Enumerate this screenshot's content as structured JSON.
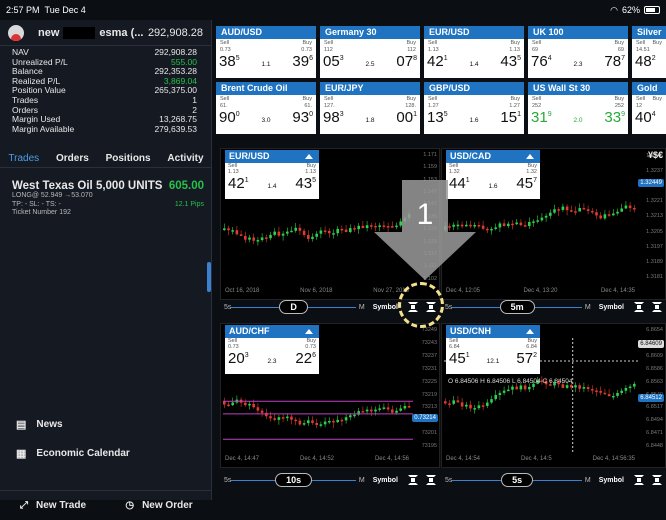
{
  "status_bar": {
    "time": "2:57 PM",
    "date": "Tue Dec 4",
    "battery": "62%"
  },
  "account": {
    "name_prefix": "new",
    "name_suffix": "esma (...",
    "balance": "292,908.28"
  },
  "stats": [
    {
      "label": "NAV",
      "value": "292,908.28",
      "green": false
    },
    {
      "label": "Unrealized P/L",
      "value": "555.00",
      "green": true
    },
    {
      "label": "Balance",
      "value": "292,353.28",
      "green": false
    },
    {
      "label": "Realized P/L",
      "value": "3,869.04",
      "green": true
    },
    {
      "label": "Position Value",
      "value": "265,375.00",
      "green": false
    },
    {
      "label": "Trades",
      "value": "1",
      "green": false
    },
    {
      "label": "Orders",
      "value": "2",
      "green": false
    },
    {
      "label": "Margin Used",
      "value": "13,268.75",
      "green": false
    },
    {
      "label": "Margin Available",
      "value": "279,639.53",
      "green": false
    }
  ],
  "tabs": [
    "Trades",
    "Orders",
    "Positions",
    "Activity"
  ],
  "position": {
    "title": "West Texas Oil 5,000 UNITS",
    "pl": "605.00",
    "entry": "LONG@ 52.949 →53.070",
    "orders": "TP: -   SL: -   TS: -",
    "pips": "12.1 Pips",
    "ticket": "Ticket Number 192"
  },
  "links": {
    "news": "News",
    "calendar": "Economic Calendar"
  },
  "bottom": {
    "new_trade": "New Trade",
    "new_order": "New Order"
  },
  "quotes": [
    {
      "name": "AUD/USD",
      "sell_small": "0.73",
      "buy_small": "0.73",
      "sell_big": "38",
      "sell_sup": "5",
      "spread": "1.1",
      "buy_big": "39",
      "buy_sup": "6",
      "green": false
    },
    {
      "name": "Germany 30",
      "sell_small": "112",
      "buy_small": "112",
      "sell_big": "05",
      "sell_sup": "3",
      "spread": "2.5",
      "buy_big": "07",
      "buy_sup": "8",
      "green": false
    },
    {
      "name": "EUR/USD",
      "sell_small": "1.13",
      "buy_small": "1.13",
      "sell_big": "42",
      "sell_sup": "1",
      "spread": "1.4",
      "buy_big": "43",
      "buy_sup": "5",
      "green": false
    },
    {
      "name": "UK 100",
      "sell_small": "69",
      "buy_small": "69",
      "sell_big": "76",
      "sell_sup": "4",
      "spread": "2.3",
      "buy_big": "78",
      "buy_sup": "7",
      "green": false
    },
    {
      "name": "Silver",
      "sell_small": "14.51",
      "buy_small": "",
      "sell_big": "48",
      "sell_sup": "2",
      "spread": "",
      "buy_big": "",
      "buy_sup": "",
      "green": false
    },
    {
      "name": "Brent Crude Oil",
      "sell_small": "61.",
      "buy_small": "61.",
      "sell_big": "90",
      "sell_sup": "0",
      "spread": "3.0",
      "buy_big": "93",
      "buy_sup": "0",
      "green": false
    },
    {
      "name": "EUR/JPY",
      "sell_small": "127.",
      "buy_small": "128.",
      "sell_big": "98",
      "sell_sup": "3",
      "spread": "1.8",
      "buy_big": "00",
      "buy_sup": "1",
      "green": false
    },
    {
      "name": "GBP/USD",
      "sell_small": "1.27",
      "buy_small": "1.27",
      "sell_big": "13",
      "sell_sup": "5",
      "spread": "1.6",
      "buy_big": "15",
      "buy_sup": "1",
      "green": false
    },
    {
      "name": "US Wall St 30",
      "sell_small": "252",
      "buy_small": "252",
      "sell_big": "31",
      "sell_sup": "9",
      "spread": "2.0",
      "buy_big": "33",
      "buy_sup": "9",
      "green": true
    },
    {
      "name": "Gold",
      "sell_small": "12",
      "buy_small": "",
      "sell_big": "40",
      "sell_sup": "4",
      "spread": "",
      "buy_big": "",
      "buy_sup": "",
      "green": false
    }
  ],
  "charts": [
    {
      "pair": "EUR/USD",
      "sell_small": "1.13",
      "buy_small": "1.13",
      "sell_big": "42",
      "sell_sup": "1",
      "spread": "1.4",
      "buy_big": "43",
      "buy_sup": "5",
      "x_labels": [
        "Oct 16, 2018",
        "Nov 6, 2018",
        "Nov 27, 2018"
      ],
      "y_labels": [
        "1.171",
        "1.159",
        "1.153",
        "1.147",
        "1.141",
        "1.135",
        "1.129",
        "1.123",
        "1.117",
        "1.111",
        "1.102"
      ],
      "interval": "D",
      "symbol": "Symbol"
    },
    {
      "pair": "USD/CAD",
      "sell_small": "1.32",
      "buy_small": "1.32",
      "sell_big": "44",
      "sell_sup": "1",
      "spread": "1.6",
      "buy_big": "45",
      "buy_sup": "7",
      "x_labels": [
        "Dec 4, 12:05",
        "Dec 4, 13:20",
        "Dec 4, 14:35"
      ],
      "y_labels": [
        "1.3245",
        "1.3237",
        "1.3229",
        "1.3221",
        "1.3213",
        "1.3205",
        "1.3197",
        "1.3189",
        "1.3181"
      ],
      "price_tag": "1.32449",
      "interval": "5m",
      "symbol": "Symbol",
      "extra_label": "¥$€"
    },
    {
      "pair": "AUD/CHF",
      "sell_small": "0.73",
      "buy_small": "0.73",
      "sell_big": "20",
      "sell_sup": "3",
      "spread": "2.3",
      "buy_big": "22",
      "buy_sup": "6",
      "x_labels": [
        "Dec 4, 14:47",
        "Dec 4, 14:52",
        "Dec 4, 14:56"
      ],
      "y_labels": [
        "73249",
        "73243",
        "73237",
        "73231",
        "73225",
        "73219",
        "73213",
        "73207",
        "73201",
        "73195"
      ],
      "price_tag": "0.73214",
      "interval": "10s",
      "symbol": "Symbol"
    },
    {
      "pair": "USD/CNH",
      "sell_small": "6.84",
      "buy_small": "6.84",
      "sell_big": "45",
      "sell_sup": "1",
      "spread": "12.1",
      "buy_big": "57",
      "buy_sup": "2",
      "x_labels": [
        "Dec 4, 14:54",
        "Dec 4, 14:5",
        "Dec 4, 14:56:35"
      ],
      "y_labels": [
        "6.8654",
        "6.8632",
        "6.8609",
        "6.8586",
        "6.8563",
        "6.8540",
        "6.8517",
        "6.8494",
        "6.8471",
        "6.8448"
      ],
      "price_tag": "6.84512",
      "cross_tag": "6.84609",
      "ohlc": "O 6.84506  H 6.84506  L 6.84504  C 6.84504",
      "interval": "5s",
      "symbol": "Symbol"
    }
  ],
  "interval_small": {
    "s": "5s",
    "m": "M"
  },
  "callout_number": "1"
}
